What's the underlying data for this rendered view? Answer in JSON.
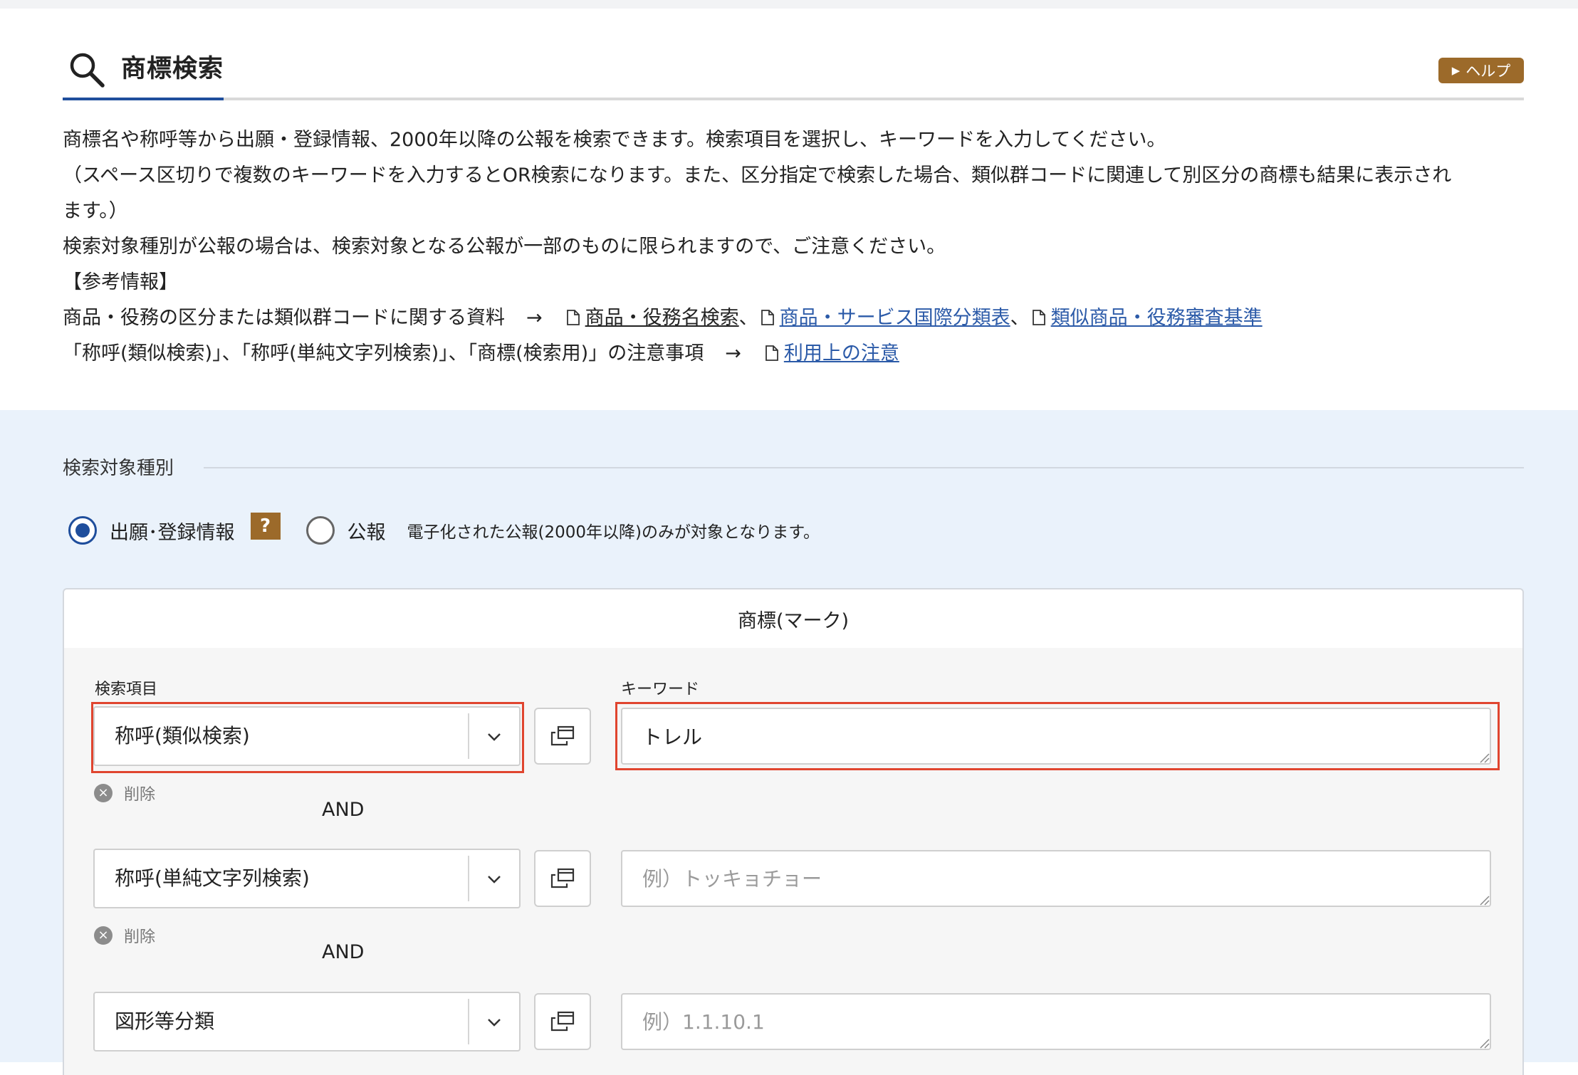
{
  "header": {
    "title": "商標検索",
    "help_label": "ヘルプ"
  },
  "description": {
    "line1": "商標名や称呼等から出願・登録情報、2000年以降の公報を検索できます。検索項目を選択し、キーワードを入力してください。",
    "line2": "（スペース区切りで複数のキーワードを入力するとOR検索になります。また、区分指定で検索した場合、類似群コードに関連して別区分の商標も結果に表示され",
    "line3": "ます。）",
    "line4": "検索対象種別が公報の場合は、検索対象となる公報が一部のものに限られますので、ご注意ください。",
    "line5": "【参考情報】",
    "ref1_text": "商品・役務の区分または類似群コードに関する資料",
    "arrow": "→",
    "ref1_links": [
      "商品・役務名検索",
      "商品・サービス国際分類表",
      "類似商品・役務審査基準"
    ],
    "separator": "、",
    "ref2_text": "「称呼(類似検索)」、「称呼(単純文字列検索)」、「商標(検索用)」の注意事項",
    "ref2_link": "利用上の注意"
  },
  "search_target": {
    "label": "検索対象種別",
    "option1": "出願･登録情報",
    "option1_checked": true,
    "qmark": "?",
    "option2": "公報",
    "option2_note": "電子化された公報(2000年以降)のみが対象となります。"
  },
  "card": {
    "title": "商標(マーク)",
    "field_label": "検索項目",
    "keyword_label": "キーワード",
    "delete_label": "削除",
    "and_label": "AND",
    "rows": [
      {
        "select": "称呼(類似検索)",
        "keyword": "トレル",
        "placeholder": ""
      },
      {
        "select": "称呼(単純文字列検索)",
        "keyword": "",
        "placeholder": "例）トッキョチョー"
      },
      {
        "select": "図形等分類",
        "keyword": "",
        "placeholder": "例）1.1.10.1"
      }
    ]
  },
  "colors": {
    "accent": "#1f4e9c",
    "help": "#9c6a2a",
    "highlight": "#e0452f",
    "link": "#2b5aa8"
  }
}
